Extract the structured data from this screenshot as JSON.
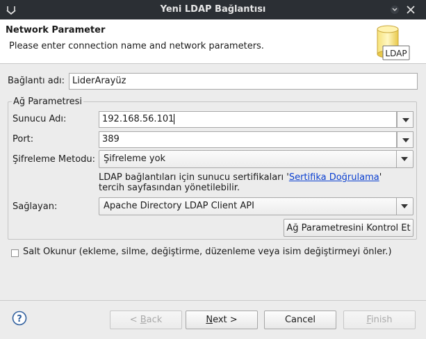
{
  "window": {
    "title": "Yeni LDAP Bağlantısı"
  },
  "header": {
    "title": "Network Parameter",
    "description": "Please enter connection name and network parameters.",
    "logo_text": "LDAP"
  },
  "connection_name": {
    "label": "Bağlantı adı:",
    "value": "LiderArayüz"
  },
  "network_group": {
    "title": "Ağ Parametresi",
    "host": {
      "label": "Sunucu Adı:",
      "value": "192.168.56.101"
    },
    "port": {
      "label": "Port:",
      "value": "389"
    },
    "encryption": {
      "label": "Şifreleme Metodu:",
      "selected": "Şifreleme yok"
    },
    "info": {
      "prefix": "LDAP bağlantıları için sunucu sertifikaları '",
      "link": "Sertifika Doğrulama",
      "suffix": "'",
      "line2": "tercih sayfasından yönetilebilir."
    },
    "provider": {
      "label": "Sağlayan:",
      "selected": "Apache Directory LDAP Client API"
    },
    "check_button": "Ağ Parametresini Kontrol Et"
  },
  "read_only": {
    "label": "Salt Okunur (ekleme, silme, değiştirme, düzenleme veya isim değiştirmeyi önler.)",
    "checked": false
  },
  "footer": {
    "back": {
      "mnemonic": "B",
      "rest": "ack",
      "prefix": "< "
    },
    "next": {
      "mnemonic": "N",
      "rest": "ext >"
    },
    "cancel": "Cancel",
    "finish": {
      "mnemonic": "F",
      "rest": "inish"
    }
  },
  "icons": {
    "title_left": "chevron-down-icon",
    "minimize": "minimize-icon",
    "close": "close-icon",
    "logo": "ldap-database-icon",
    "help": "help-icon"
  },
  "colors": {
    "titlebar": "#2b2f34",
    "link": "#0a3fd0",
    "background": "#ececec"
  }
}
